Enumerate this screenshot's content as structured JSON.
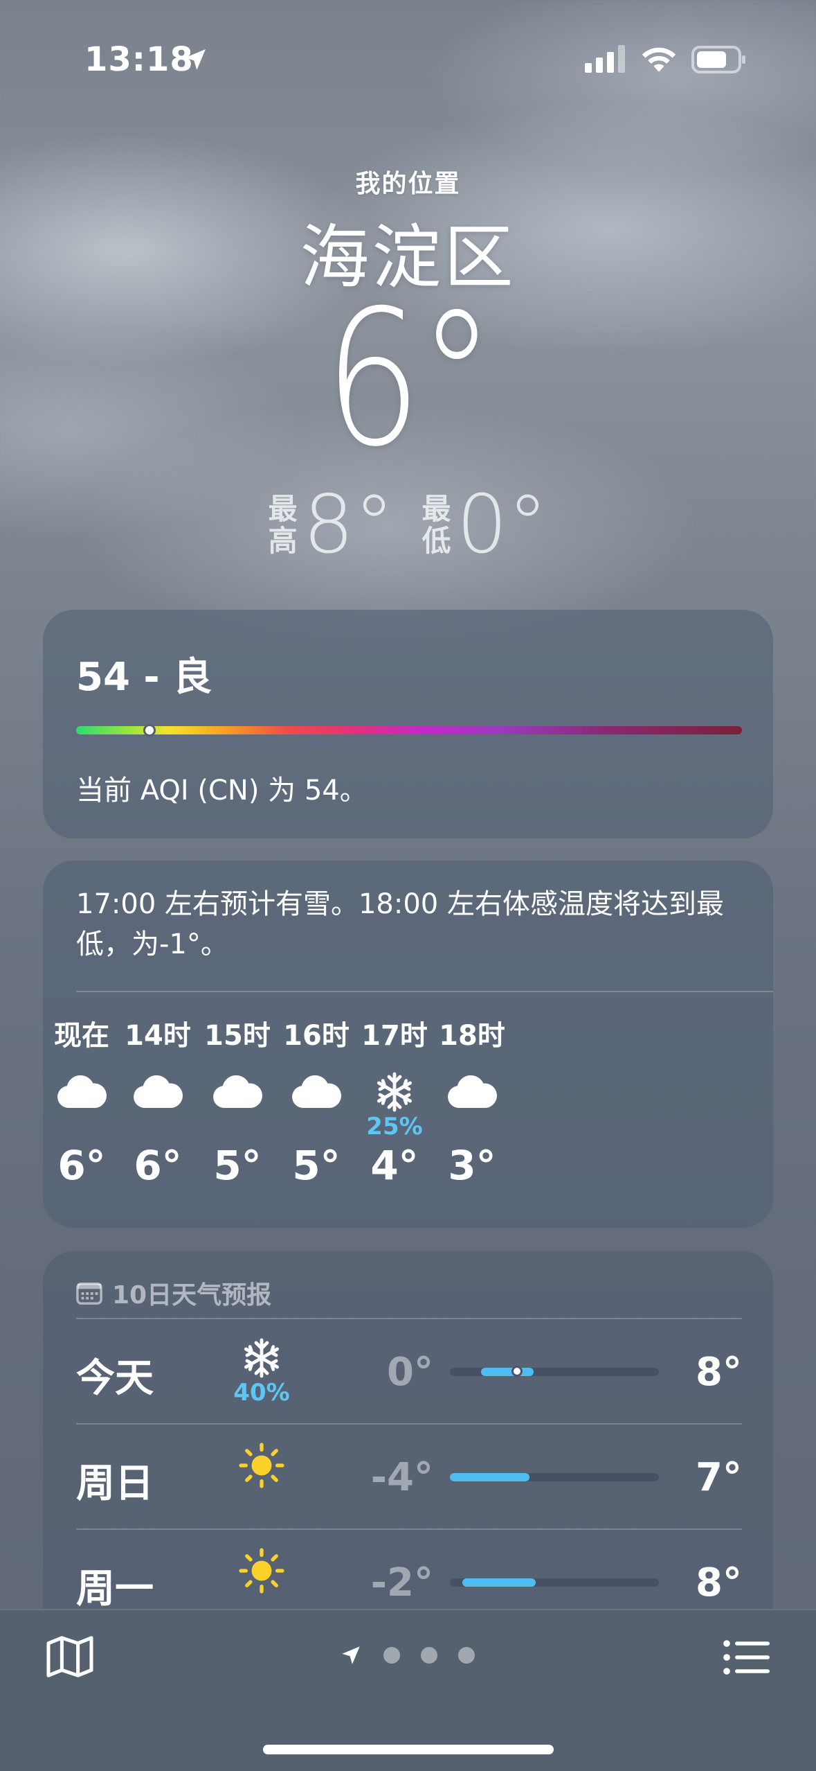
{
  "status_bar": {
    "time": "13:18"
  },
  "header": {
    "location_label": "我的位置",
    "city": "海淀区",
    "current_temp": "6°",
    "high_label_1": "最",
    "high_label_2": "高",
    "high": "8°",
    "low_label_1": "最",
    "low_label_2": "低",
    "low": "0°"
  },
  "aqi": {
    "title": "54 - 良",
    "description": "当前 AQI (CN) 为 54。",
    "value": 54,
    "indicator_fraction": 0.11
  },
  "hourly": {
    "summary": "17:00 左右预计有雪。18:00 左右体感温度将达到最低，为-1°。",
    "hours": [
      {
        "label": "现在",
        "icon": "cloud-icon",
        "precip": "",
        "temp": "6°"
      },
      {
        "label": "14时",
        "icon": "cloud-icon",
        "precip": "",
        "temp": "6°"
      },
      {
        "label": "15时",
        "icon": "cloud-icon",
        "precip": "",
        "temp": "5°"
      },
      {
        "label": "16时",
        "icon": "cloud-icon",
        "precip": "",
        "temp": "5°"
      },
      {
        "label": "17时",
        "icon": "snowflake-icon",
        "precip": "25%",
        "temp": "4°"
      },
      {
        "label": "18时",
        "icon": "cloud-icon",
        "precip": "",
        "temp": "3°"
      }
    ]
  },
  "daily": {
    "title": "10日天气预报",
    "days": [
      {
        "name": "今天",
        "icon": "snowflake-icon",
        "precip": "40%",
        "low": "0°",
        "high": "8°",
        "range_start": 0.15,
        "range_end": 0.4,
        "current_marker": 0.32
      },
      {
        "name": "周日",
        "icon": "sun-icon",
        "precip": "",
        "low": "-4°",
        "high": "7°",
        "range_start": 0.0,
        "range_end": 0.38
      },
      {
        "name": "周一",
        "icon": "sun-icon",
        "precip": "",
        "low": "-2°",
        "high": "8°",
        "range_start": 0.06,
        "range_end": 0.41
      }
    ]
  },
  "colors": {
    "precip_blue": "#5ec6f4",
    "temp_bar": "#4fbdf0"
  }
}
